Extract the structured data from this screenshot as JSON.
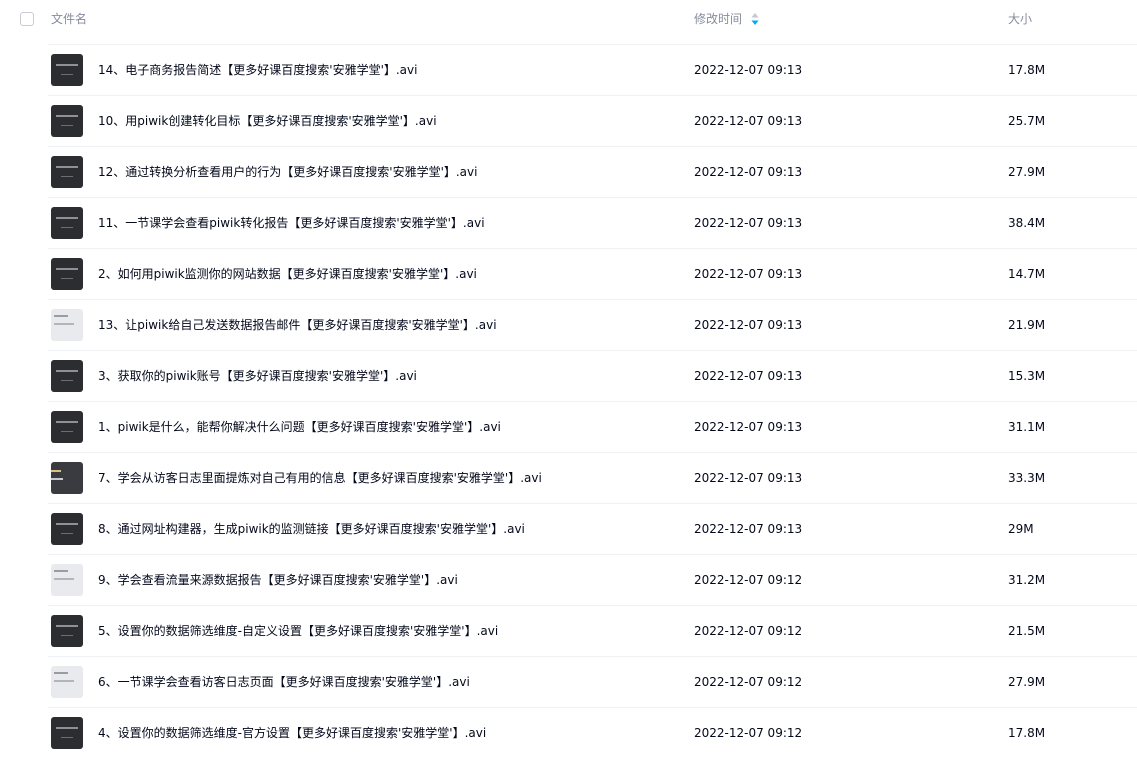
{
  "header": {
    "name_label": "文件名",
    "modified_label": "修改时间",
    "size_label": "大小",
    "sort_icon": "sort-arrows-icon",
    "accent_color": "#06a7ff"
  },
  "files": [
    {
      "name": "14、电子商务报告简述【更多好课百度搜索'安雅学堂'】.avi",
      "date": "2022-12-07 09:13",
      "size": "17.8M"
    },
    {
      "name": "10、用piwik创建转化目标【更多好课百度搜索'安雅学堂'】.avi",
      "date": "2022-12-07 09:13",
      "size": "25.7M"
    },
    {
      "name": "12、通过转换分析查看用户的行为【更多好课百度搜索'安雅学堂'】.avi",
      "date": "2022-12-07 09:13",
      "size": "27.9M"
    },
    {
      "name": "11、一节课学会查看piwik转化报告【更多好课百度搜索'安雅学堂'】.avi",
      "date": "2022-12-07 09:13",
      "size": "38.4M"
    },
    {
      "name": "2、如何用piwik监测你的网站数据【更多好课百度搜索'安雅学堂'】.avi",
      "date": "2022-12-07 09:13",
      "size": "14.7M"
    },
    {
      "name": "13、让piwik给自己发送数据报告邮件【更多好课百度搜索'安雅学堂'】.avi",
      "date": "2022-12-07 09:13",
      "size": "21.9M"
    },
    {
      "name": "3、获取你的piwik账号【更多好课百度搜索'安雅学堂'】.avi",
      "date": "2022-12-07 09:13",
      "size": "15.3M"
    },
    {
      "name": "1、piwik是什么，能帮你解决什么问题【更多好课百度搜索'安雅学堂'】.avi",
      "date": "2022-12-07 09:13",
      "size": "31.1M"
    },
    {
      "name": "7、学会从访客日志里面提炼对自己有用的信息【更多好课百度搜索'安雅学堂'】.avi",
      "date": "2022-12-07 09:13",
      "size": "33.3M"
    },
    {
      "name": "8、通过网址构建器，生成piwik的监测链接【更多好课百度搜索'安雅学堂'】.avi",
      "date": "2022-12-07 09:13",
      "size": "29M"
    },
    {
      "name": "9、学会查看流量来源数据报告【更多好课百度搜索'安雅学堂'】.avi",
      "date": "2022-12-07 09:12",
      "size": "31.2M"
    },
    {
      "name": "5、设置你的数据筛选维度-自定义设置【更多好课百度搜索'安雅学堂'】.avi",
      "date": "2022-12-07 09:12",
      "size": "21.5M"
    },
    {
      "name": "6、一节课学会查看访客日志页面【更多好课百度搜索'安雅学堂'】.avi",
      "date": "2022-12-07 09:12",
      "size": "27.9M"
    },
    {
      "name": "4、设置你的数据筛选维度-官方设置【更多好课百度搜索'安雅学堂'】.avi",
      "date": "2022-12-07 09:12",
      "size": "17.8M"
    }
  ]
}
